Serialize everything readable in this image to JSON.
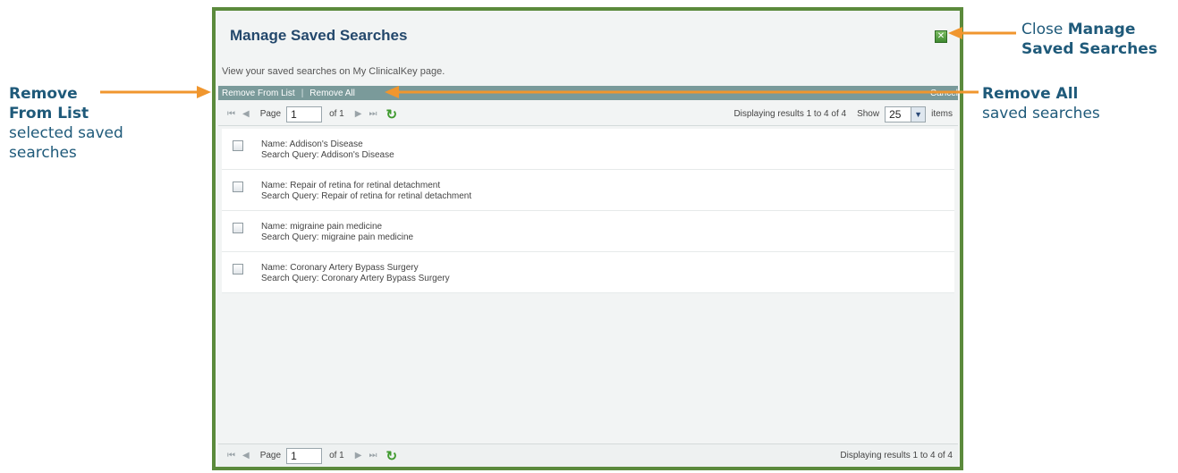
{
  "dialog": {
    "title": "Manage Saved Searches",
    "close_icon": "close-x-icon",
    "description": "View your saved searches on My ClinicalKey page."
  },
  "actions": {
    "remove_from_list": "Remove From List",
    "separator": "|",
    "remove_all": "Remove All",
    "cancel": "Cancel"
  },
  "pager": {
    "page_label": "Page",
    "page_value": "1",
    "of_label": "of 1",
    "display_text": "Displaying results 1 to 4 of 4",
    "show_label": "Show",
    "show_value": "25",
    "items_label": "items"
  },
  "searches": [
    {
      "name": "Name: Addison's Disease",
      "query": "Search Query: Addison's Disease"
    },
    {
      "name": "Name: Repair of retina for retinal detachment",
      "query": "Search Query: Repair of retina for retinal detachment"
    },
    {
      "name": "Name: migraine pain medicine",
      "query": "Search Query: migraine pain medicine"
    },
    {
      "name": "Name: Coronary Artery Bypass Surgery",
      "query": "Search Query: Coronary Artery Bypass Surgery"
    }
  ],
  "annotations": {
    "remove_from_list": {
      "bold1": "Remove",
      "bold2": "From List",
      "rest1": "selected saved",
      "rest2": "searches"
    },
    "remove_all": {
      "bold": "Remove All",
      "rest": "saved searches"
    },
    "close": {
      "plain": "Close ",
      "bold1": "Manage",
      "bold2": "Saved Searches"
    }
  },
  "colors": {
    "dialog_border": "#5b8a3c",
    "action_bar": "#7a9a9a",
    "annotation_arrow": "#f0962e",
    "annotation_text": "#1f5a7a"
  }
}
